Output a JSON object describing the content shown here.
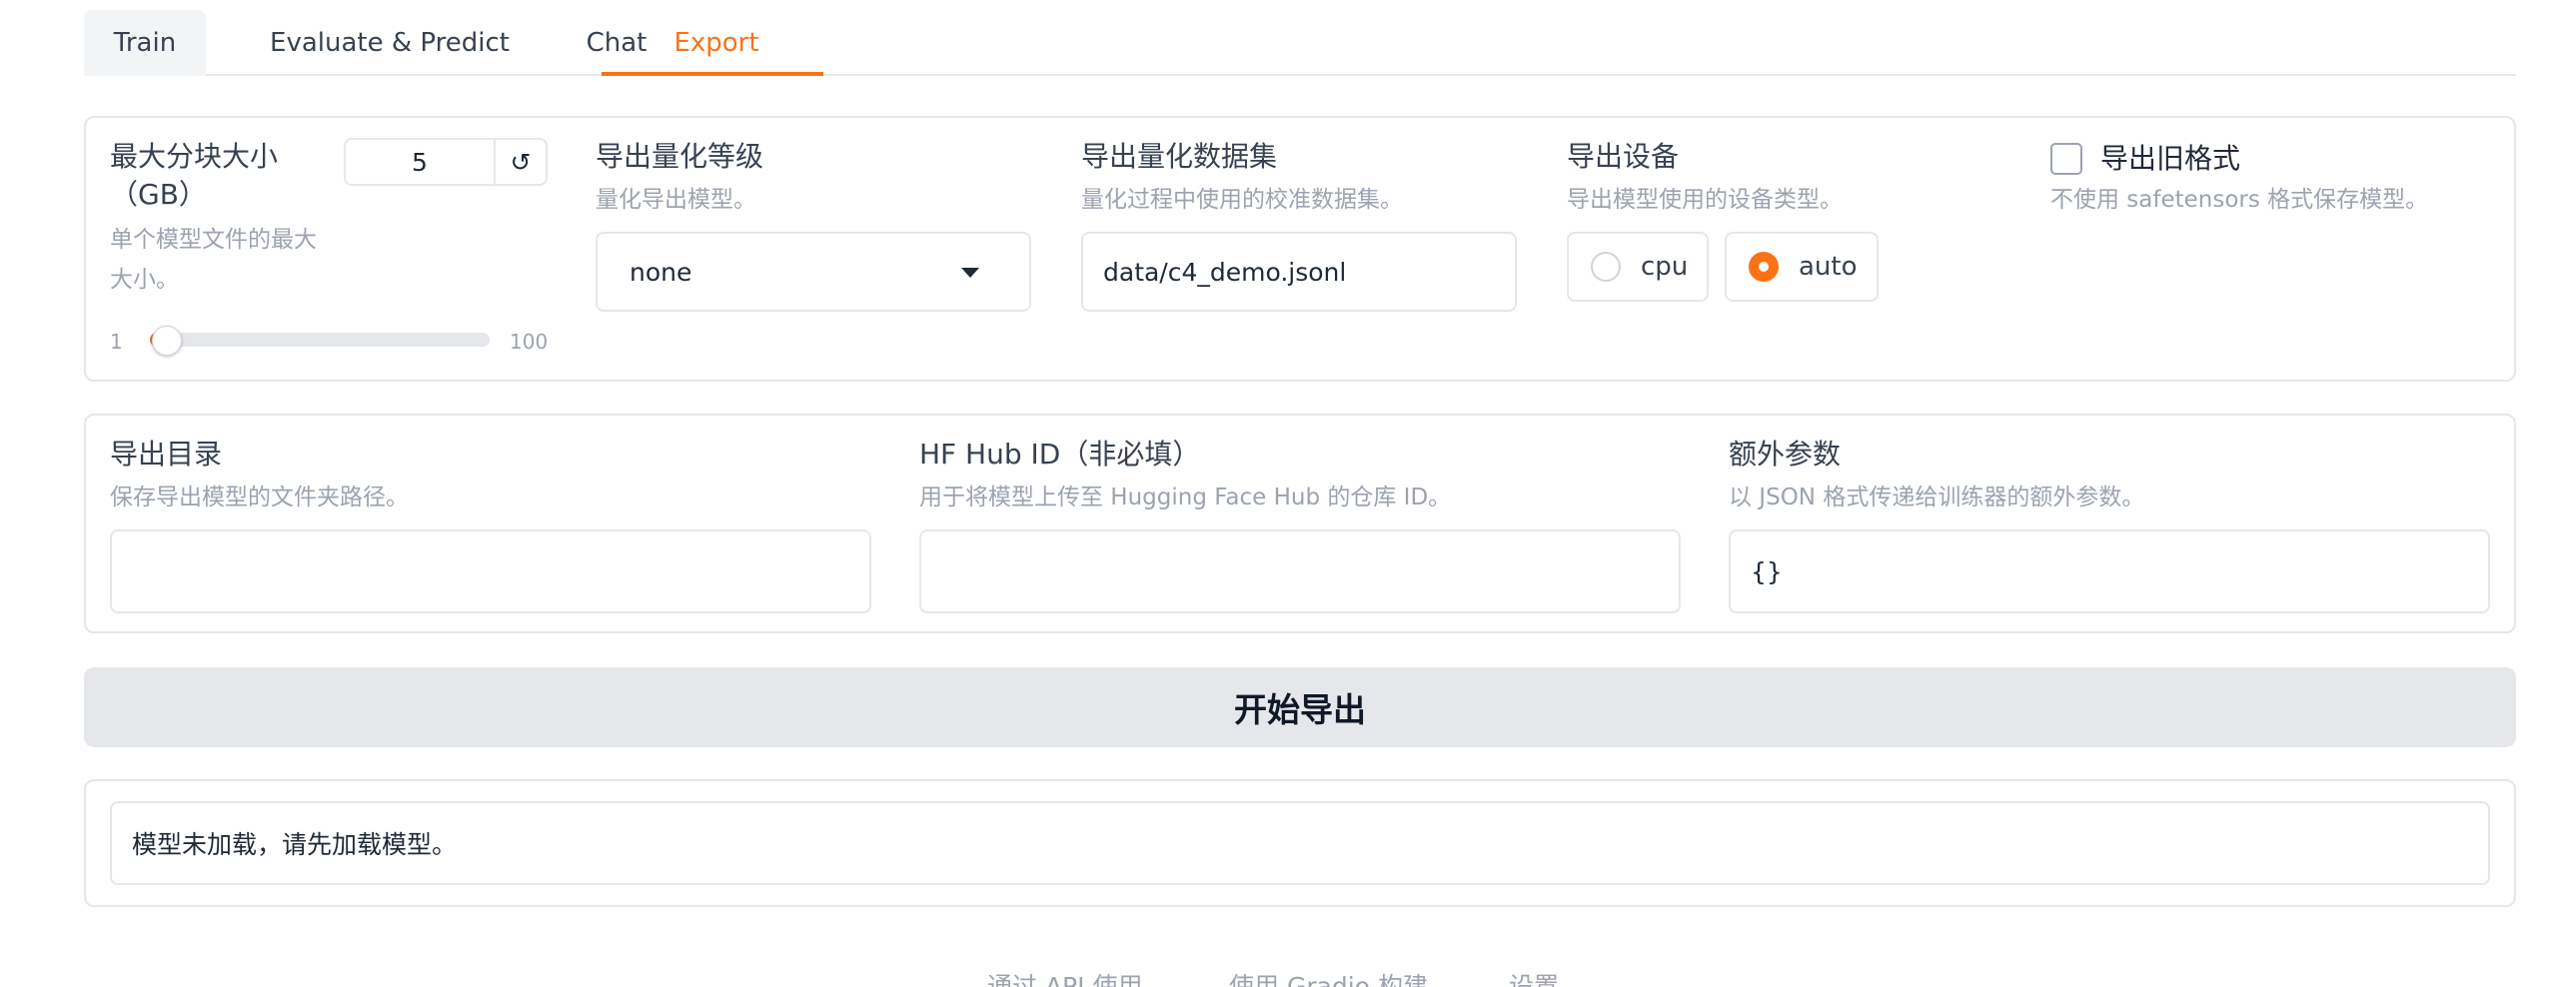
{
  "tabs": [
    {
      "label": "Train"
    },
    {
      "label": "Evaluate & Predict"
    },
    {
      "label": "Chat"
    },
    {
      "label": "Export"
    }
  ],
  "active_tab": "Export",
  "accent_color": "#f97316",
  "max_shard": {
    "label_line1": "最大分块大小",
    "label_line2": "（GB）",
    "desc_line1": "单个模型文件的最大",
    "desc_line2": "大小。",
    "value": "5",
    "reset_icon": "↺",
    "slider_min": "1",
    "slider_max": "100",
    "slider_level": 0.04
  },
  "quantization_bit": {
    "label": "导出量化等级",
    "desc": "量化导出模型。",
    "value": "none"
  },
  "quantization_dataset": {
    "label": "导出量化数据集",
    "desc": "量化过程中使用的校准数据集。",
    "value": "data/c4_demo.jsonl"
  },
  "export_device": {
    "label": "导出设备",
    "desc": "导出模型使用的设备类型。",
    "options": [
      "cpu",
      "auto"
    ],
    "selected": "auto"
  },
  "legacy_format": {
    "label": "导出旧格式",
    "desc": "不使用 safetensors 格式保存模型。",
    "checked": false
  },
  "export_dir": {
    "label": "导出目录",
    "desc": "保存导出模型的文件夹路径。",
    "value": ""
  },
  "hub_id": {
    "label": "HF Hub ID（非必填）",
    "desc": "用于将模型上传至 Hugging Face Hub 的仓库 ID。",
    "value": ""
  },
  "extra_args": {
    "label": "额外参数",
    "desc": "以 JSON 格式传递给训练器的额外参数。",
    "value": "{}"
  },
  "export_button": "开始导出",
  "output": "模型未加载，请先加载模型。",
  "footer": {
    "api": "通过 API 使用",
    "gradio": "使用 Gradio 构建",
    "settings": "设置"
  }
}
